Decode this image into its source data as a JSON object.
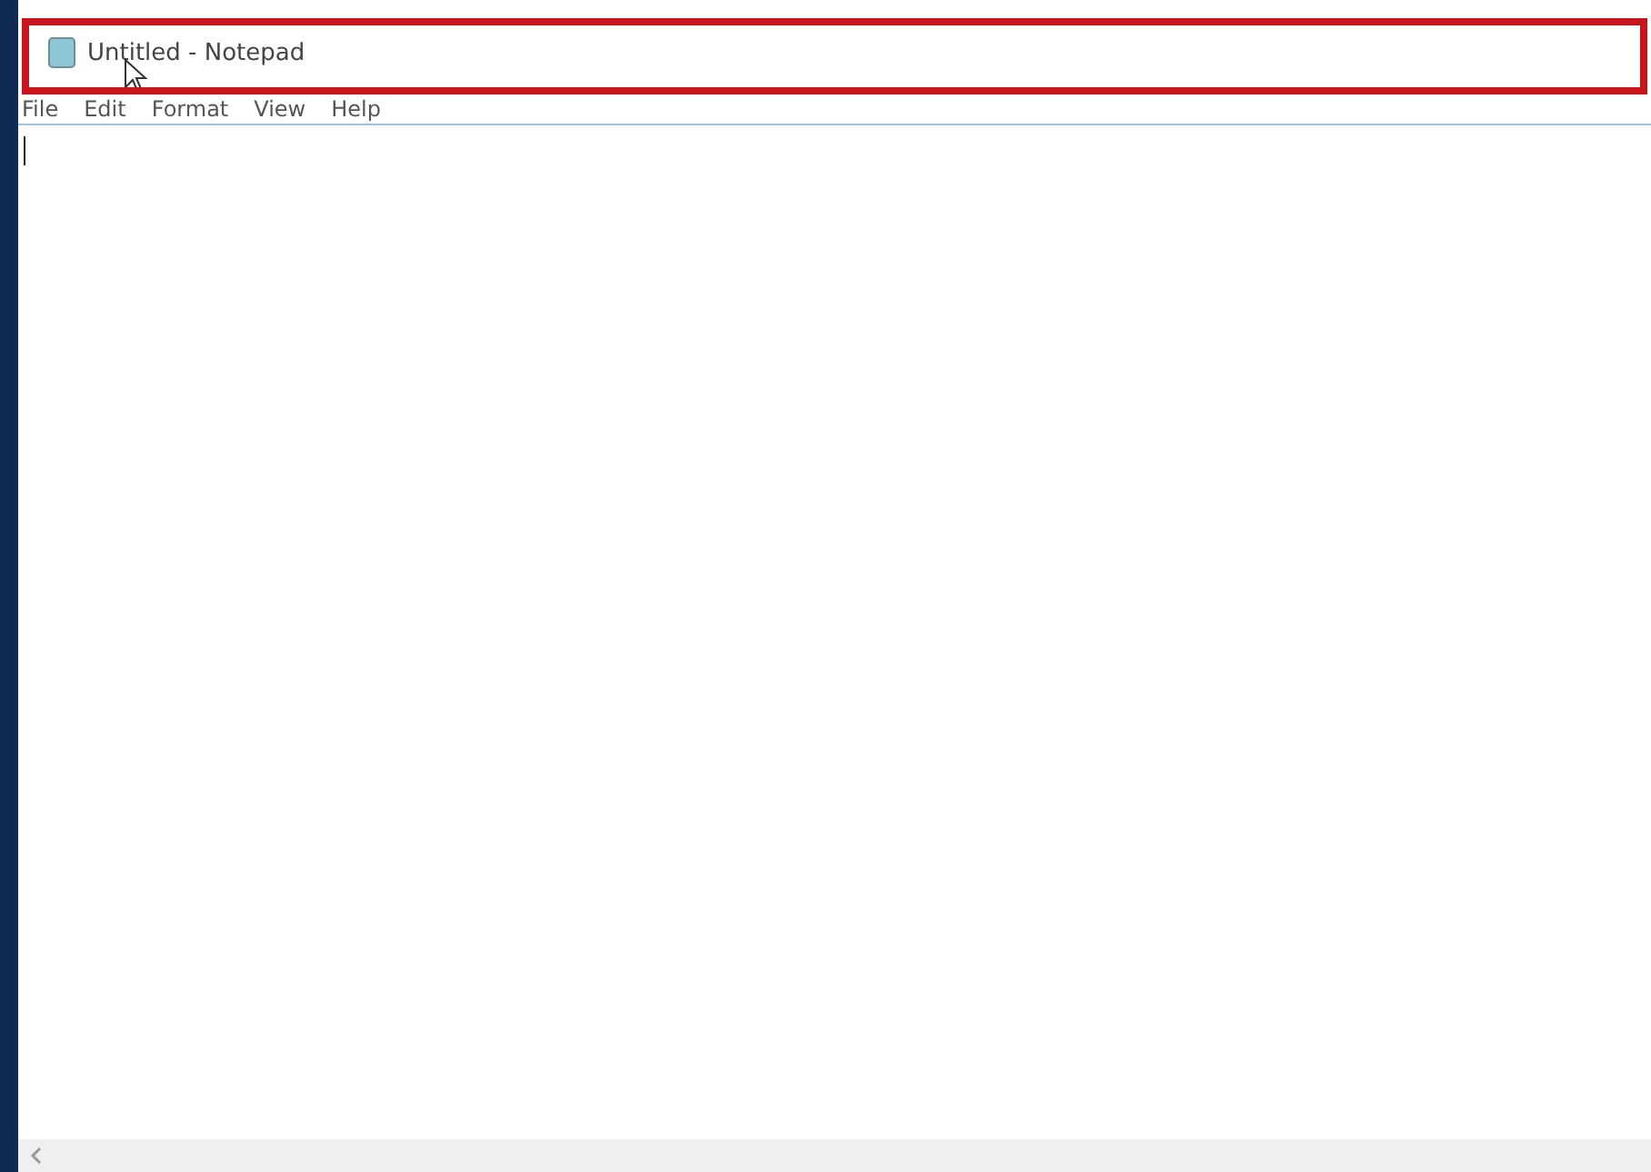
{
  "window": {
    "title": "Untitled - Notepad"
  },
  "menu": [
    "File",
    "Edit",
    "Format",
    "View",
    "Help"
  ]
}
